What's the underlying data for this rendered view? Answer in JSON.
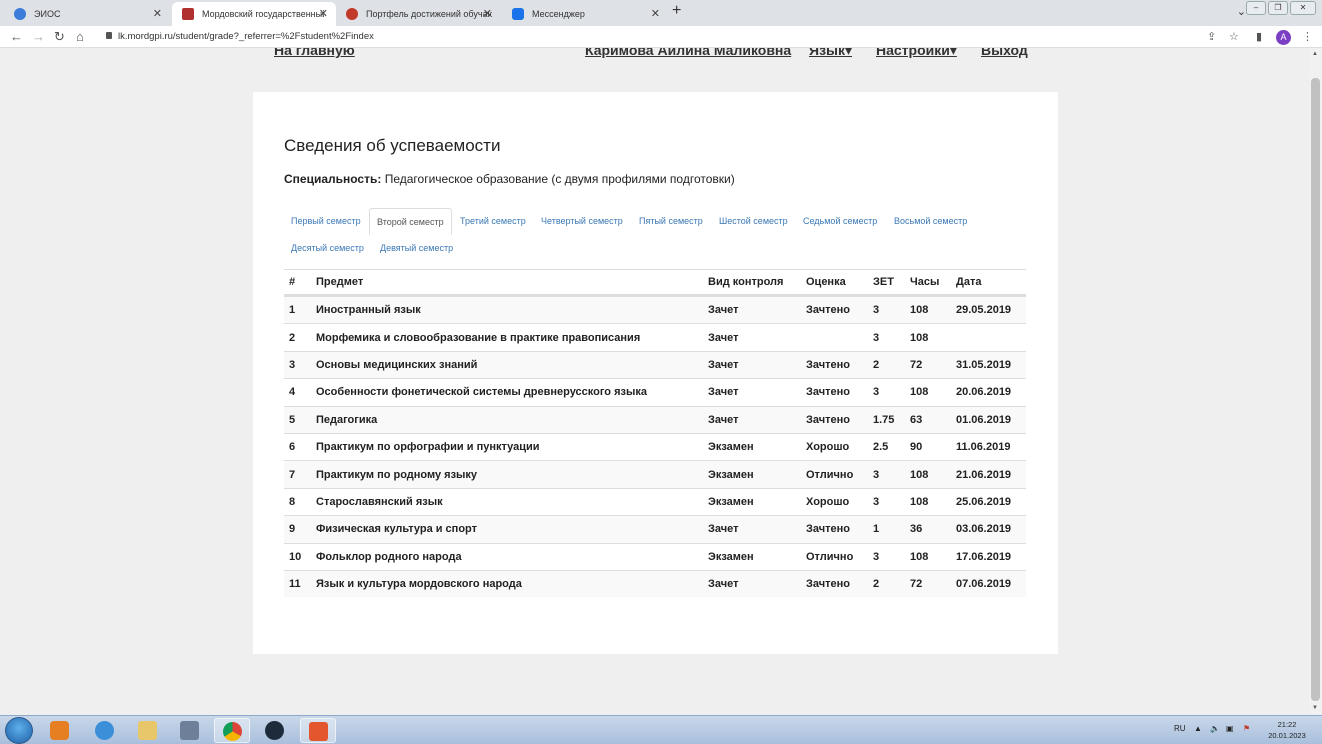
{
  "browser": {
    "tabs": [
      {
        "title": "ЭИОС",
        "icon_color": "#3b7dd8"
      },
      {
        "title": "Мордовский государственный",
        "icon_color": "#b03030"
      },
      {
        "title": "Портфель достижений обучающ",
        "icon_color": "#c0392b"
      },
      {
        "title": "Мессенджер",
        "icon_color": "#1a73e8"
      }
    ],
    "url": "lk.mordgpi.ru/student/grade?_referrer=%2Fstudent%2Findex",
    "avatar_letter": "A"
  },
  "topnav": {
    "home": "На главную",
    "user": "Каримова Аилина Маликовна",
    "lang": "Язык▾",
    "settings": "Настройки▾",
    "logout": "Выход"
  },
  "page": {
    "title": "Сведения об успеваемости",
    "spec_label": "Специальность:",
    "spec_value": "Педагогическое образование (с двумя профилями подготовки)"
  },
  "semesters": [
    "Первый семестр",
    "Второй семестр",
    "Третий семестр",
    "Четвертый семестр",
    "Пятый семестр",
    "Шестой семестр",
    "Седьмой семестр",
    "Восьмой семестр",
    "Десятый семестр",
    "Девятый семестр"
  ],
  "active_semester": "Второй семестр",
  "table": {
    "headers": [
      "#",
      "Предмет",
      "Вид контроля",
      "Оценка",
      "ЗЕТ",
      "Часы",
      "Дата"
    ],
    "rows": [
      [
        "1",
        "Иностранный язык",
        "Зачет",
        "Зачтено",
        "3",
        "108",
        "29.05.2019"
      ],
      [
        "2",
        "Морфемика и словообразование в практике правописания",
        "Зачет",
        "",
        "3",
        "108",
        ""
      ],
      [
        "3",
        "Основы медицинских знаний",
        "Зачет",
        "Зачтено",
        "2",
        "72",
        "31.05.2019"
      ],
      [
        "4",
        "Особенности фонетической системы древнерусского языка",
        "Зачет",
        "Зачтено",
        "3",
        "108",
        "20.06.2019"
      ],
      [
        "5",
        "Педагогика",
        "Зачет",
        "Зачтено",
        "1.75",
        "63",
        "01.06.2019"
      ],
      [
        "6",
        "Практикум по орфографии и пунктуации",
        "Экзамен",
        "Хорошо",
        "2.5",
        "90",
        "11.06.2019"
      ],
      [
        "7",
        "Практикум по родному языку",
        "Экзамен",
        "Отлично",
        "3",
        "108",
        "21.06.2019"
      ],
      [
        "8",
        "Старославянский язык",
        "Экзамен",
        "Хорошо",
        "3",
        "108",
        "25.06.2019"
      ],
      [
        "9",
        "Физическая культура и спорт",
        "Зачет",
        "Зачтено",
        "1",
        "36",
        "03.06.2019"
      ],
      [
        "10",
        "Фольклор родного народа",
        "Экзамен",
        "Отлично",
        "3",
        "108",
        "17.06.2019"
      ],
      [
        "11",
        "Язык и культура мордовского народа",
        "Зачет",
        "Зачтено",
        "2",
        "72",
        "07.06.2019"
      ]
    ]
  },
  "taskbar": {
    "lang": "RU",
    "time": "21:22",
    "date": "20.01.2023"
  }
}
